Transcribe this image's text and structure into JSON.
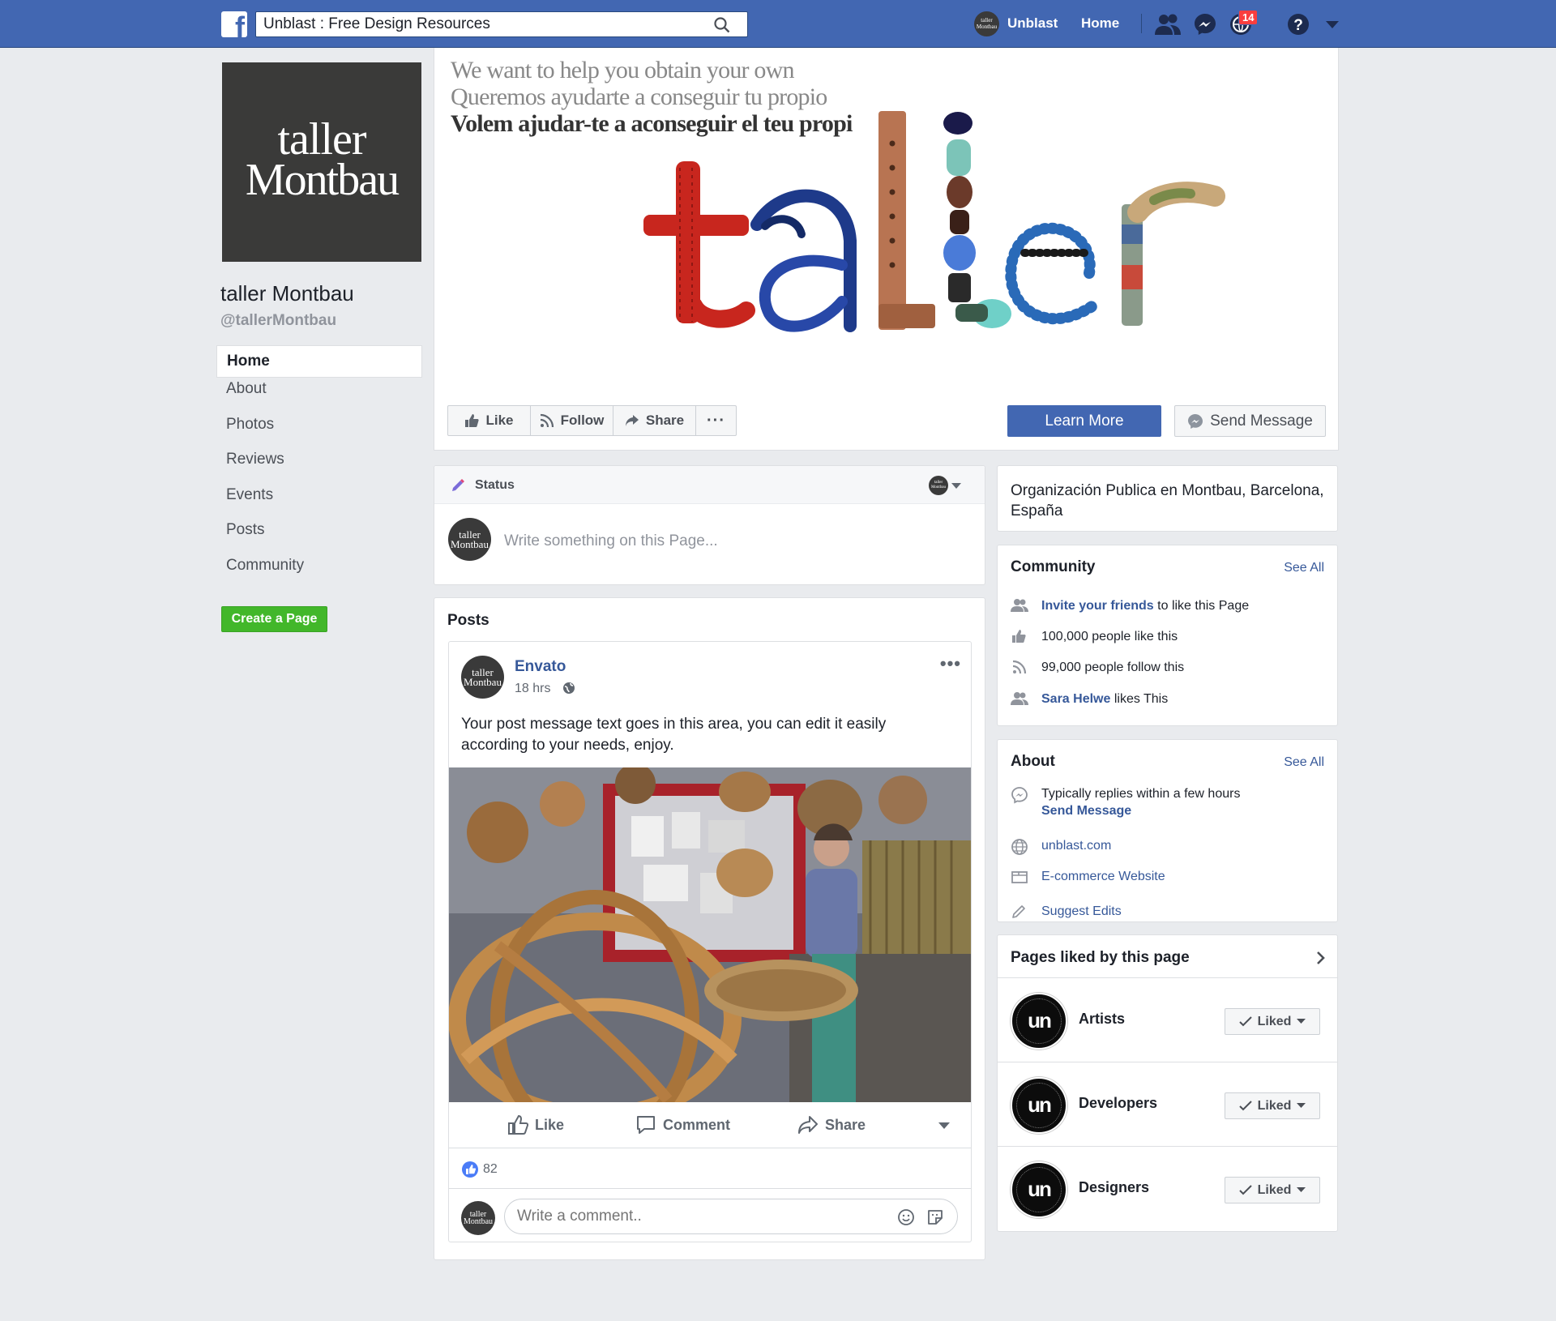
{
  "topbar": {
    "logo_letter": "f",
    "search_value": "Unblast : Free Design Resources",
    "search_placeholder": "Search",
    "username": "Unblast",
    "home_label": "Home",
    "notification_count": "14",
    "bar_color": "#4267b2",
    "icons": [
      "search-icon",
      "friend-requests-icon",
      "messenger-icon",
      "notifications-icon",
      "help-icon",
      "account-menu-caret-icon"
    ]
  },
  "profile": {
    "picture_line1": "taller",
    "picture_line2": "Montbau",
    "name": "taller Montbau",
    "handle": "@tallerMontbau"
  },
  "left_nav": {
    "items": [
      "Home",
      "About",
      "Photos",
      "Reviews",
      "Events",
      "Posts",
      "Community"
    ],
    "active": "Home",
    "create_page_label": "Create a Page"
  },
  "cover": {
    "line1": "We want to help you obtain your own",
    "line2": "Queremos ayudarte a conseguir tu propio",
    "line3": "Volem ajudar-te a aconseguir el teu propi",
    "word": "taller",
    "like_label": "Like",
    "follow_label": "Follow",
    "share_label": "Share",
    "more_label": "···",
    "learn_more_label": "Learn More",
    "send_message_label": "Send Message",
    "accent_color": "#4267b2"
  },
  "status_box": {
    "tab_label": "Status",
    "placeholder": "Write something on this Page...",
    "avatar_line1": "taller",
    "avatar_line2": "Montbau"
  },
  "posts": {
    "section_title": "Posts",
    "items": [
      {
        "author": "Envato",
        "time": "18 hrs",
        "text": "Your post message text goes in this area, you can edit it easily according to your needs, enjoy.",
        "actions": [
          "Like",
          "Comment",
          "Share"
        ],
        "reaction_count": "82",
        "comment_placeholder": "Write a comment.."
      }
    ]
  },
  "sidebar_right": {
    "location": "Organización Publica en Montbau, Barcelona, España",
    "community": {
      "title": "Community",
      "see_all": "See All",
      "invite_link": "Invite your friends",
      "invite_rest": "to like this Page",
      "likes": "100,000 people like this",
      "follows": "99,000 people follow this",
      "friend_name": "Sara Helwe",
      "friend_rest": "likes This"
    },
    "about": {
      "title": "About",
      "see_all": "See All",
      "reply_time": "Typically replies within a few hours",
      "send_message": "Send Message",
      "website": "unblast.com",
      "ecommerce": "E-commerce Website",
      "suggest_edits": "Suggest Edits"
    },
    "pages_liked": {
      "title": "Pages liked by this page",
      "avatar_text": "un",
      "liked_label": "Liked",
      "pages": [
        "Artists",
        "Developers",
        "Designers"
      ]
    }
  }
}
